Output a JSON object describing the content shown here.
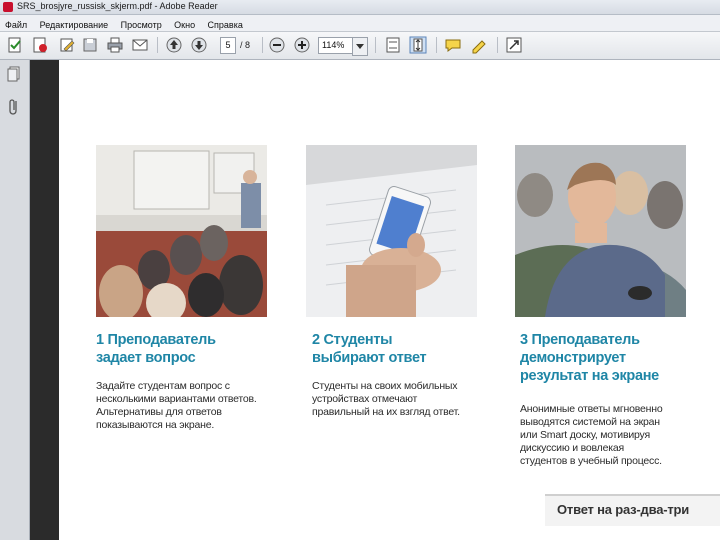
{
  "window": {
    "title": "SRS_brosjyre_russisk_skjerm.pdf - Adobe Reader"
  },
  "menu": {
    "items": [
      "Файл",
      "Редактирование",
      "Просмотр",
      "Окно",
      "Справка"
    ]
  },
  "toolbar": {
    "page_current": "5",
    "page_total": "/ 8",
    "zoom": "114%"
  },
  "document": {
    "steps": [
      {
        "heading_line1": "1 Преподаватель",
        "heading_line2": "задает вопрос",
        "heading_line3": "",
        "body_lines": [
          "Задайте студентам вопрос с",
          "несколькими вариантами ответов.",
          "Альтернативы для ответов",
          "показываются на экране."
        ]
      },
      {
        "heading_line1": "2 Студенты",
        "heading_line2": "выбирают ответ",
        "heading_line3": "",
        "body_lines": [
          "Студенты на своих мобильных",
          "устройствах отмечают",
          "правильный на их взгляд ответ."
        ]
      },
      {
        "heading_line1": "3 Преподаватель",
        "heading_line2": "демонстрирует",
        "heading_line3": "результат на экране",
        "body_lines": [
          "Анонимные ответы мгновенно",
          "выводятся системой на экран",
          "или Smart доску, мотивируя",
          "дискуссию и вовлекая",
          "студентов в учебный процесс."
        ]
      }
    ],
    "tagline": "Ответ на раз-два-три"
  }
}
